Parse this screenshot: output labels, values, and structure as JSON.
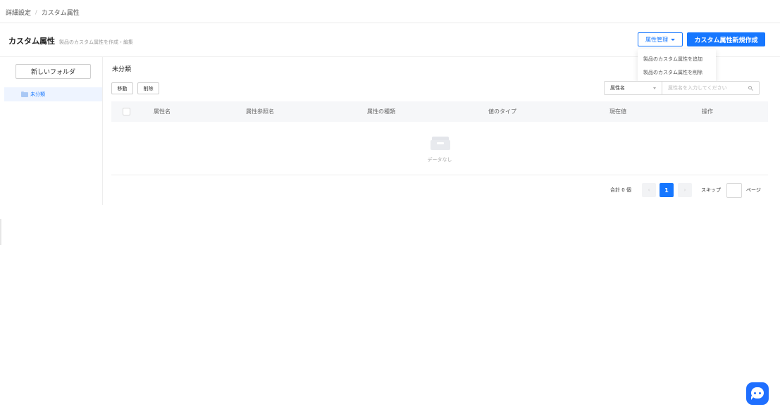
{
  "breadcrumb": {
    "items": [
      "詳細設定",
      "カスタム属性"
    ],
    "separator": "/"
  },
  "header": {
    "title": "カスタム属性",
    "subtitle": "製品のカスタム属性を作成・編集",
    "manage_label": "属性管理",
    "create_label": "カスタム属性新規作成"
  },
  "dropdown": {
    "items": [
      "製品のカスタム属性を追加",
      "製品のカスタム属性を削除"
    ]
  },
  "sidebar": {
    "new_folder_label": "新しいフォルダ",
    "folders": [
      {
        "label": "未分類",
        "selected": true
      }
    ]
  },
  "main": {
    "section_title": "未分類",
    "move_label": "移動",
    "delete_label": "削除",
    "search": {
      "field": "属性名",
      "placeholder": "属性名を入力してください"
    },
    "columns": [
      "属性名",
      "属性参照名",
      "属性の種類",
      "値のタイプ",
      "現在値",
      "操作"
    ],
    "rows": [],
    "empty_text": "データなし"
  },
  "pagination": {
    "total_text": "合計 0 個",
    "current_page": "1",
    "prev_symbol": "‹",
    "next_symbol": "›",
    "skip_label": "スキップ",
    "page_label": "ページ"
  },
  "colors": {
    "accent": "#1677ff",
    "chat": "#1f6fff",
    "table_header_bg": "#f6f7f9"
  },
  "icons": {
    "folder": "folder-icon",
    "search": "search-icon",
    "empty": "empty-box-icon",
    "chat": "chat-icon"
  }
}
